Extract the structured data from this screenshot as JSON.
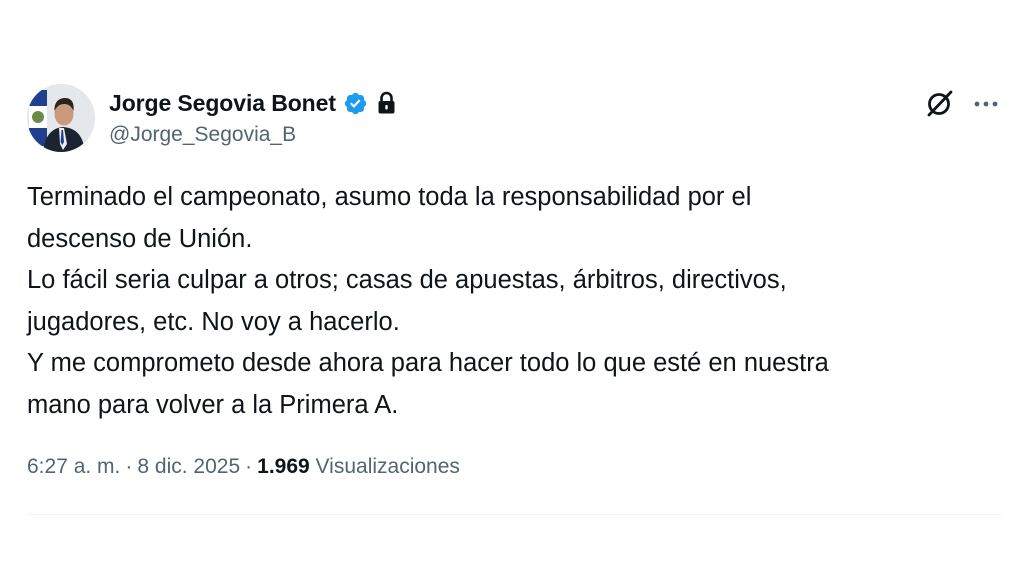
{
  "author": {
    "display_name": "Jorge Segovia Bonet",
    "handle": "@Jorge_Segovia_B",
    "verified": true,
    "protected": true,
    "avatar_icon": "profile-photo"
  },
  "header_actions": {
    "grok_icon": "grok-icon",
    "more_icon": "more-icon"
  },
  "tweet": {
    "lines": [
      "Terminado el campeonato, asumo toda la responsabilidad por el",
      "descenso de Unión.",
      "Lo fácil seria culpar a otros; casas de apuestas, árbitros, directivos,",
      "jugadores, etc. No voy a hacerlo.",
      "Y me comprometo desde ahora para hacer todo lo que esté en nuestra",
      "mano para volver a la Primera A."
    ]
  },
  "meta": {
    "time": "6:27 a. m.",
    "separator": "·",
    "date": "8 dic. 2025",
    "views_count": "1.969",
    "views_label": "Visualizaciones"
  },
  "colors": {
    "text_primary": "#0f1419",
    "text_secondary": "#536471",
    "verified_blue": "#1d9bf0",
    "divider": "#eff3f4"
  }
}
